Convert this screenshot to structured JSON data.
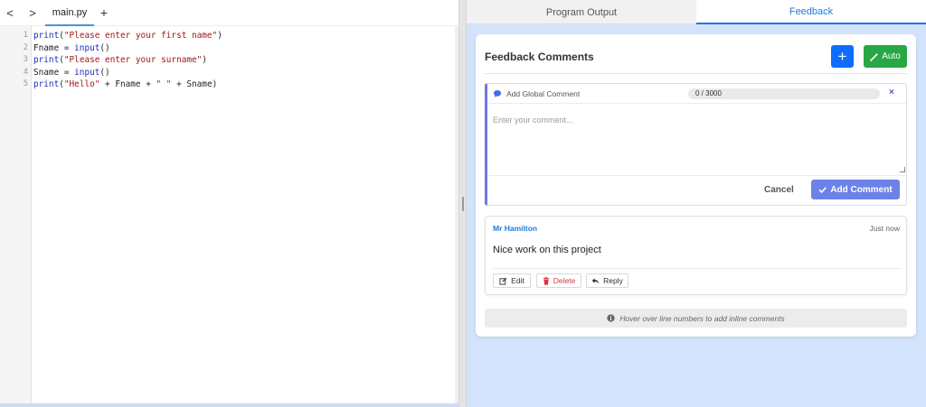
{
  "editor": {
    "nav_back": "<",
    "nav_forward": ">",
    "active_file": "main.py",
    "add_tab": "+",
    "line_numbers": [
      "1",
      "2",
      "3",
      "4",
      "5"
    ],
    "code": [
      [
        {
          "t": "print",
          "k": "fn"
        },
        {
          "t": "(",
          "k": "var"
        },
        {
          "t": "\"Please enter your first name\"",
          "k": "str"
        },
        {
          "t": ")",
          "k": "var"
        }
      ],
      [
        {
          "t": "Fname = ",
          "k": "var"
        },
        {
          "t": "input",
          "k": "fn"
        },
        {
          "t": "()",
          "k": "var"
        }
      ],
      [
        {
          "t": "print",
          "k": "fn"
        },
        {
          "t": "(",
          "k": "var"
        },
        {
          "t": "\"Please enter your surname\"",
          "k": "str"
        },
        {
          "t": ")",
          "k": "var"
        }
      ],
      [
        {
          "t": "Sname = ",
          "k": "var"
        },
        {
          "t": "input",
          "k": "fn"
        },
        {
          "t": "()",
          "k": "var"
        }
      ],
      [
        {
          "t": "print",
          "k": "fn"
        },
        {
          "t": "(",
          "k": "var"
        },
        {
          "t": "\"Hello\"",
          "k": "str"
        },
        {
          "t": " + Fname + ",
          "k": "var"
        },
        {
          "t": "\" \"",
          "k": "str"
        },
        {
          "t": " + Sname)",
          "k": "var"
        }
      ]
    ]
  },
  "panel_tabs": {
    "output": "Program Output",
    "feedback": "Feedback"
  },
  "feedback": {
    "title": "Feedback Comments",
    "add_button": "+",
    "auto_button": "Auto",
    "global_comment": {
      "label": "Add Global Comment",
      "counter": "0 / 3000",
      "close": "×",
      "value": "",
      "placeholder": "Enter your comment...",
      "cancel_label": "Cancel",
      "submit_label": "Add Comment"
    },
    "comments": [
      {
        "author": "Mr Hamilton",
        "time": "Just now",
        "text": "Nice work on this project",
        "edit_label": "Edit",
        "delete_label": "Delete",
        "reply_label": "Reply"
      }
    ],
    "hint": "Hover over line numbers to add inline comments"
  },
  "colors": {
    "accent": "#1f7ae0",
    "primary_button": "#0d6efd",
    "auto_button": "#28a745",
    "add_comment_button": "#6b82e8",
    "delete_text": "#dc3545",
    "panel_background": "#d3e3fb"
  }
}
